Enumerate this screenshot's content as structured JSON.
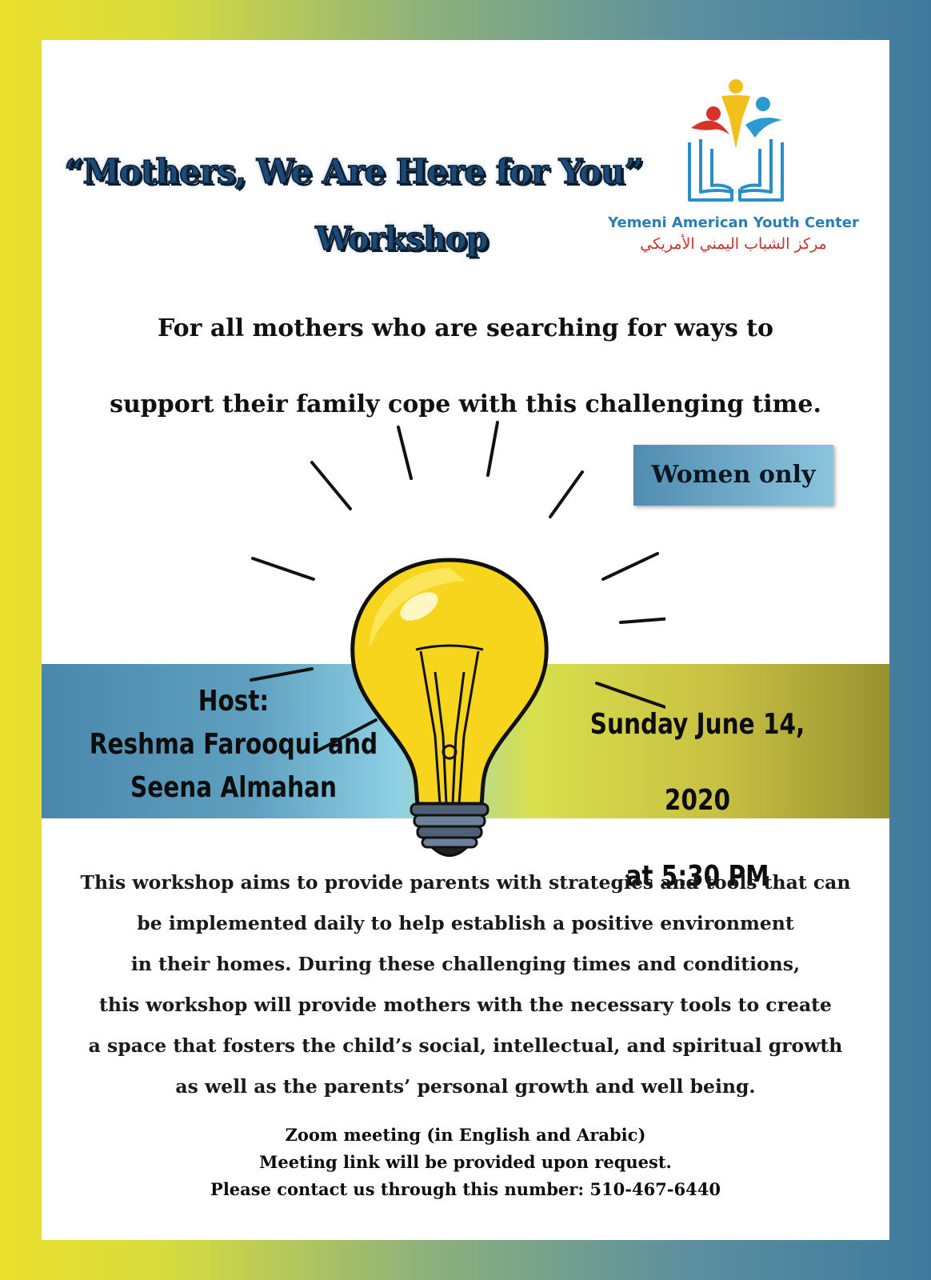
{
  "title": {
    "line1": "“Mothers, We Are Here for You”",
    "line2": "Workshop"
  },
  "logo": {
    "name_en": "Yemeni American Youth Center",
    "name_ar": "مركز الشباب اليمني الأمريكي"
  },
  "intro": {
    "line1": "For all mothers who are searching for ways to",
    "line2": "support their family cope with this challenging time."
  },
  "badge": "Women only",
  "host": {
    "label": "Host:",
    "names_line1": "Reshma Farooqui and",
    "names_line2": "Seena Almahan"
  },
  "schedule": {
    "date": "Sunday June 14, 2020",
    "time": "at 5:30 PM"
  },
  "description": [
    "This workshop aims to provide parents with strategies and tools that can",
    "be implemented daily to help establish a positive environment",
    "in their homes. During these challenging times and conditions,",
    "this workshop will provide mothers with the necessary tools to create",
    "a space that fosters the child’s social, intellectual, and spiritual growth",
    "as well as the parents’ personal growth and well being."
  ],
  "contact": [
    "Zoom meeting (in English and Arabic)",
    "Meeting link will be provided upon request.",
    "Please contact us through this number: 510-467-6440"
  ],
  "colors": {
    "title": "#1c4a78",
    "logo_en": "#2a7eb3",
    "logo_ar": "#c8322d",
    "bulb": "#f7d51c"
  },
  "icons": [
    "youth-center-logo-icon",
    "lightbulb-icon"
  ]
}
